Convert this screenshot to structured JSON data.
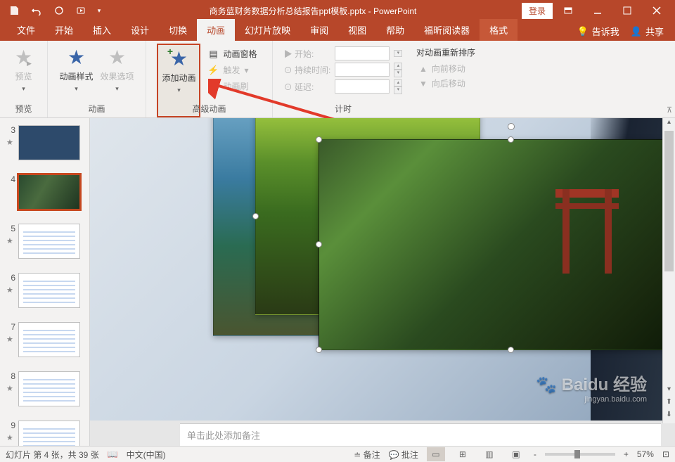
{
  "title": {
    "filename": "商务蓝财务数据分析总结报告ppt模板.pptx",
    "app": "PowerPoint",
    "login": "登录"
  },
  "tabs": {
    "file": "文件",
    "home": "开始",
    "insert": "插入",
    "design": "设计",
    "transition": "切换",
    "animation": "动画",
    "slideshow": "幻灯片放映",
    "review": "审阅",
    "view": "视图",
    "help": "帮助",
    "foxit": "福昕阅读器",
    "format": "格式",
    "tell_me": "告诉我",
    "share": "共享"
  },
  "ribbon": {
    "preview": {
      "label": "预览",
      "group": "预览"
    },
    "anim_group": "动画",
    "anim_style": "动画样式",
    "effect_options": "效果选项",
    "adv_group": "高级动画",
    "add_anim": "添加动画",
    "anim_pane": "动画窗格",
    "trigger": "触发",
    "anim_painter": "动画刷",
    "timing_group": "计时",
    "start": "开始:",
    "duration": "持续时间:",
    "delay": "延迟:",
    "reorder_title": "对动画重新排序",
    "move_earlier": "向前移动",
    "move_later": "向后移动"
  },
  "thumbs": [
    {
      "n": "3"
    },
    {
      "n": "4"
    },
    {
      "n": "5"
    },
    {
      "n": "6"
    },
    {
      "n": "7"
    },
    {
      "n": "8"
    },
    {
      "n": "9"
    }
  ],
  "notes": {
    "placeholder": "单击此处添加备注"
  },
  "status": {
    "slide_info": "幻灯片 第 4 张，共 39 张",
    "lang": "中文(中国)",
    "notes_btn": "备注",
    "comments_btn": "批注",
    "zoom": "57%",
    "minus": "-",
    "plus": "+"
  },
  "watermark": {
    "brand": "Baidu 经验",
    "sub": "jingyan.baidu.com"
  }
}
